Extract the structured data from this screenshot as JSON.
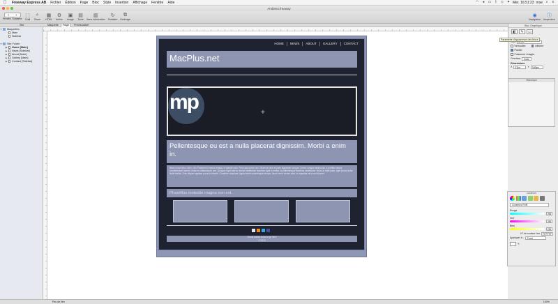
{
  "menubar": {
    "apple": "",
    "items": [
      "Freeway Express AB",
      "Fichier",
      "Édition",
      "Page",
      "Bloc",
      "Style",
      "Insertion",
      "Affichage",
      "Fenêtre",
      "Aide"
    ],
    "clock": "Mer. 16:51:23",
    "user": "mse"
  },
  "window": {
    "title": "Ambient.freeway"
  },
  "toolbar": {
    "nav_label": "Précéd. Suivante",
    "buttons": [
      "Outil",
      "Zoom",
      "HTML",
      "Action",
      "Image",
      "Texte",
      "Sans imbrication",
      "Rotation",
      "Ombrage"
    ],
    "right_buttons": [
      "Navigateur",
      "Inspecteur"
    ]
  },
  "tabstrip": {
    "site_label": "Site",
    "tabs": [
      "Maquette",
      "Page",
      "Prévisualiser"
    ],
    "selected_tab": "Page"
  },
  "sidebar": {
    "maquettes_group": "Maquettes",
    "maquettes": [
      "Main",
      "Sidebar"
    ],
    "site_group": "Site Folder",
    "pages": [
      "Home [Main]",
      "News [Sidebar]",
      "About [Main]",
      "Gallery [Main]",
      "Contact [Sidebar]"
    ]
  },
  "page": {
    "nav": [
      "HOME",
      "NEWS",
      "ABOUT",
      "GALLERY",
      "CONTACT"
    ],
    "logo": "MacPlus.net",
    "hero_logo": "mp",
    "headline": "Pellentesque eu est a nulla placerat dignissim. Morbi a enim in.",
    "body_lead": "Nam",
    "body_link": "consectetur dolor odio",
    "body_text": "Praesent id metus massa, ut blandit odio. Proin quis tortor orci. Etiam at risus et justo dignissim congue. Donec congue lacinia dui, a porttitor lectus condimentum laoreet. Nunc eu ullamcorper orci. Quisque eget odio ac lectus vestibulum faucibus eget in metus. In pellentesque faucibus vestibulum. Nulla at nulla justo, eget luctus tortor. Nulla facilisi. Duis aliquet egestas purus in blandit. Curabitur vulputate, ligula lacinia scelerisque tempor, lacus lacus ornare ante, ac egestas est urna sit amet.",
    "subheading": "Phasellus molestie magna non est.",
    "footer_line1": "Social media icons to go here",
    "footer_line2": "© 2012"
  },
  "inspector": {
    "title": "Bloc Graphique",
    "tooltip": "Paramètre d'apparence des blocs",
    "title_label": "Titre",
    "title_value": "item9",
    "checkboxes": [
      "Verrouiller",
      "Afficher",
      "Publier",
      "Fusionner Images"
    ],
    "overflow_label": "Overflow",
    "overflow_value": "Auto",
    "dimensions_label": "Dimensions",
    "x_label": "X",
    "x_value": "37px",
    "y_label": "Y",
    "y_value": "180px",
    "history_label": "Historique"
  },
  "colorpanel": {
    "title": "Couleurs",
    "mode": "Curseurs RVB",
    "sliders": [
      {
        "label": "Rouge",
        "value": "255"
      },
      {
        "label": "Vert",
        "value": "255"
      },
      {
        "label": "Bleu",
        "value": "255"
      }
    ],
    "hex_label": "N° de couleur hex",
    "hex_value": "FFFFFF",
    "apply_label": "Appliquer à :",
    "apply_value": "Fond"
  },
  "statusbar": {
    "left": "Pas de lien",
    "zoom": "100%"
  },
  "colors": {
    "page_bg": "#1f2230",
    "block": "#8d95b3",
    "border": "#6e7796"
  }
}
